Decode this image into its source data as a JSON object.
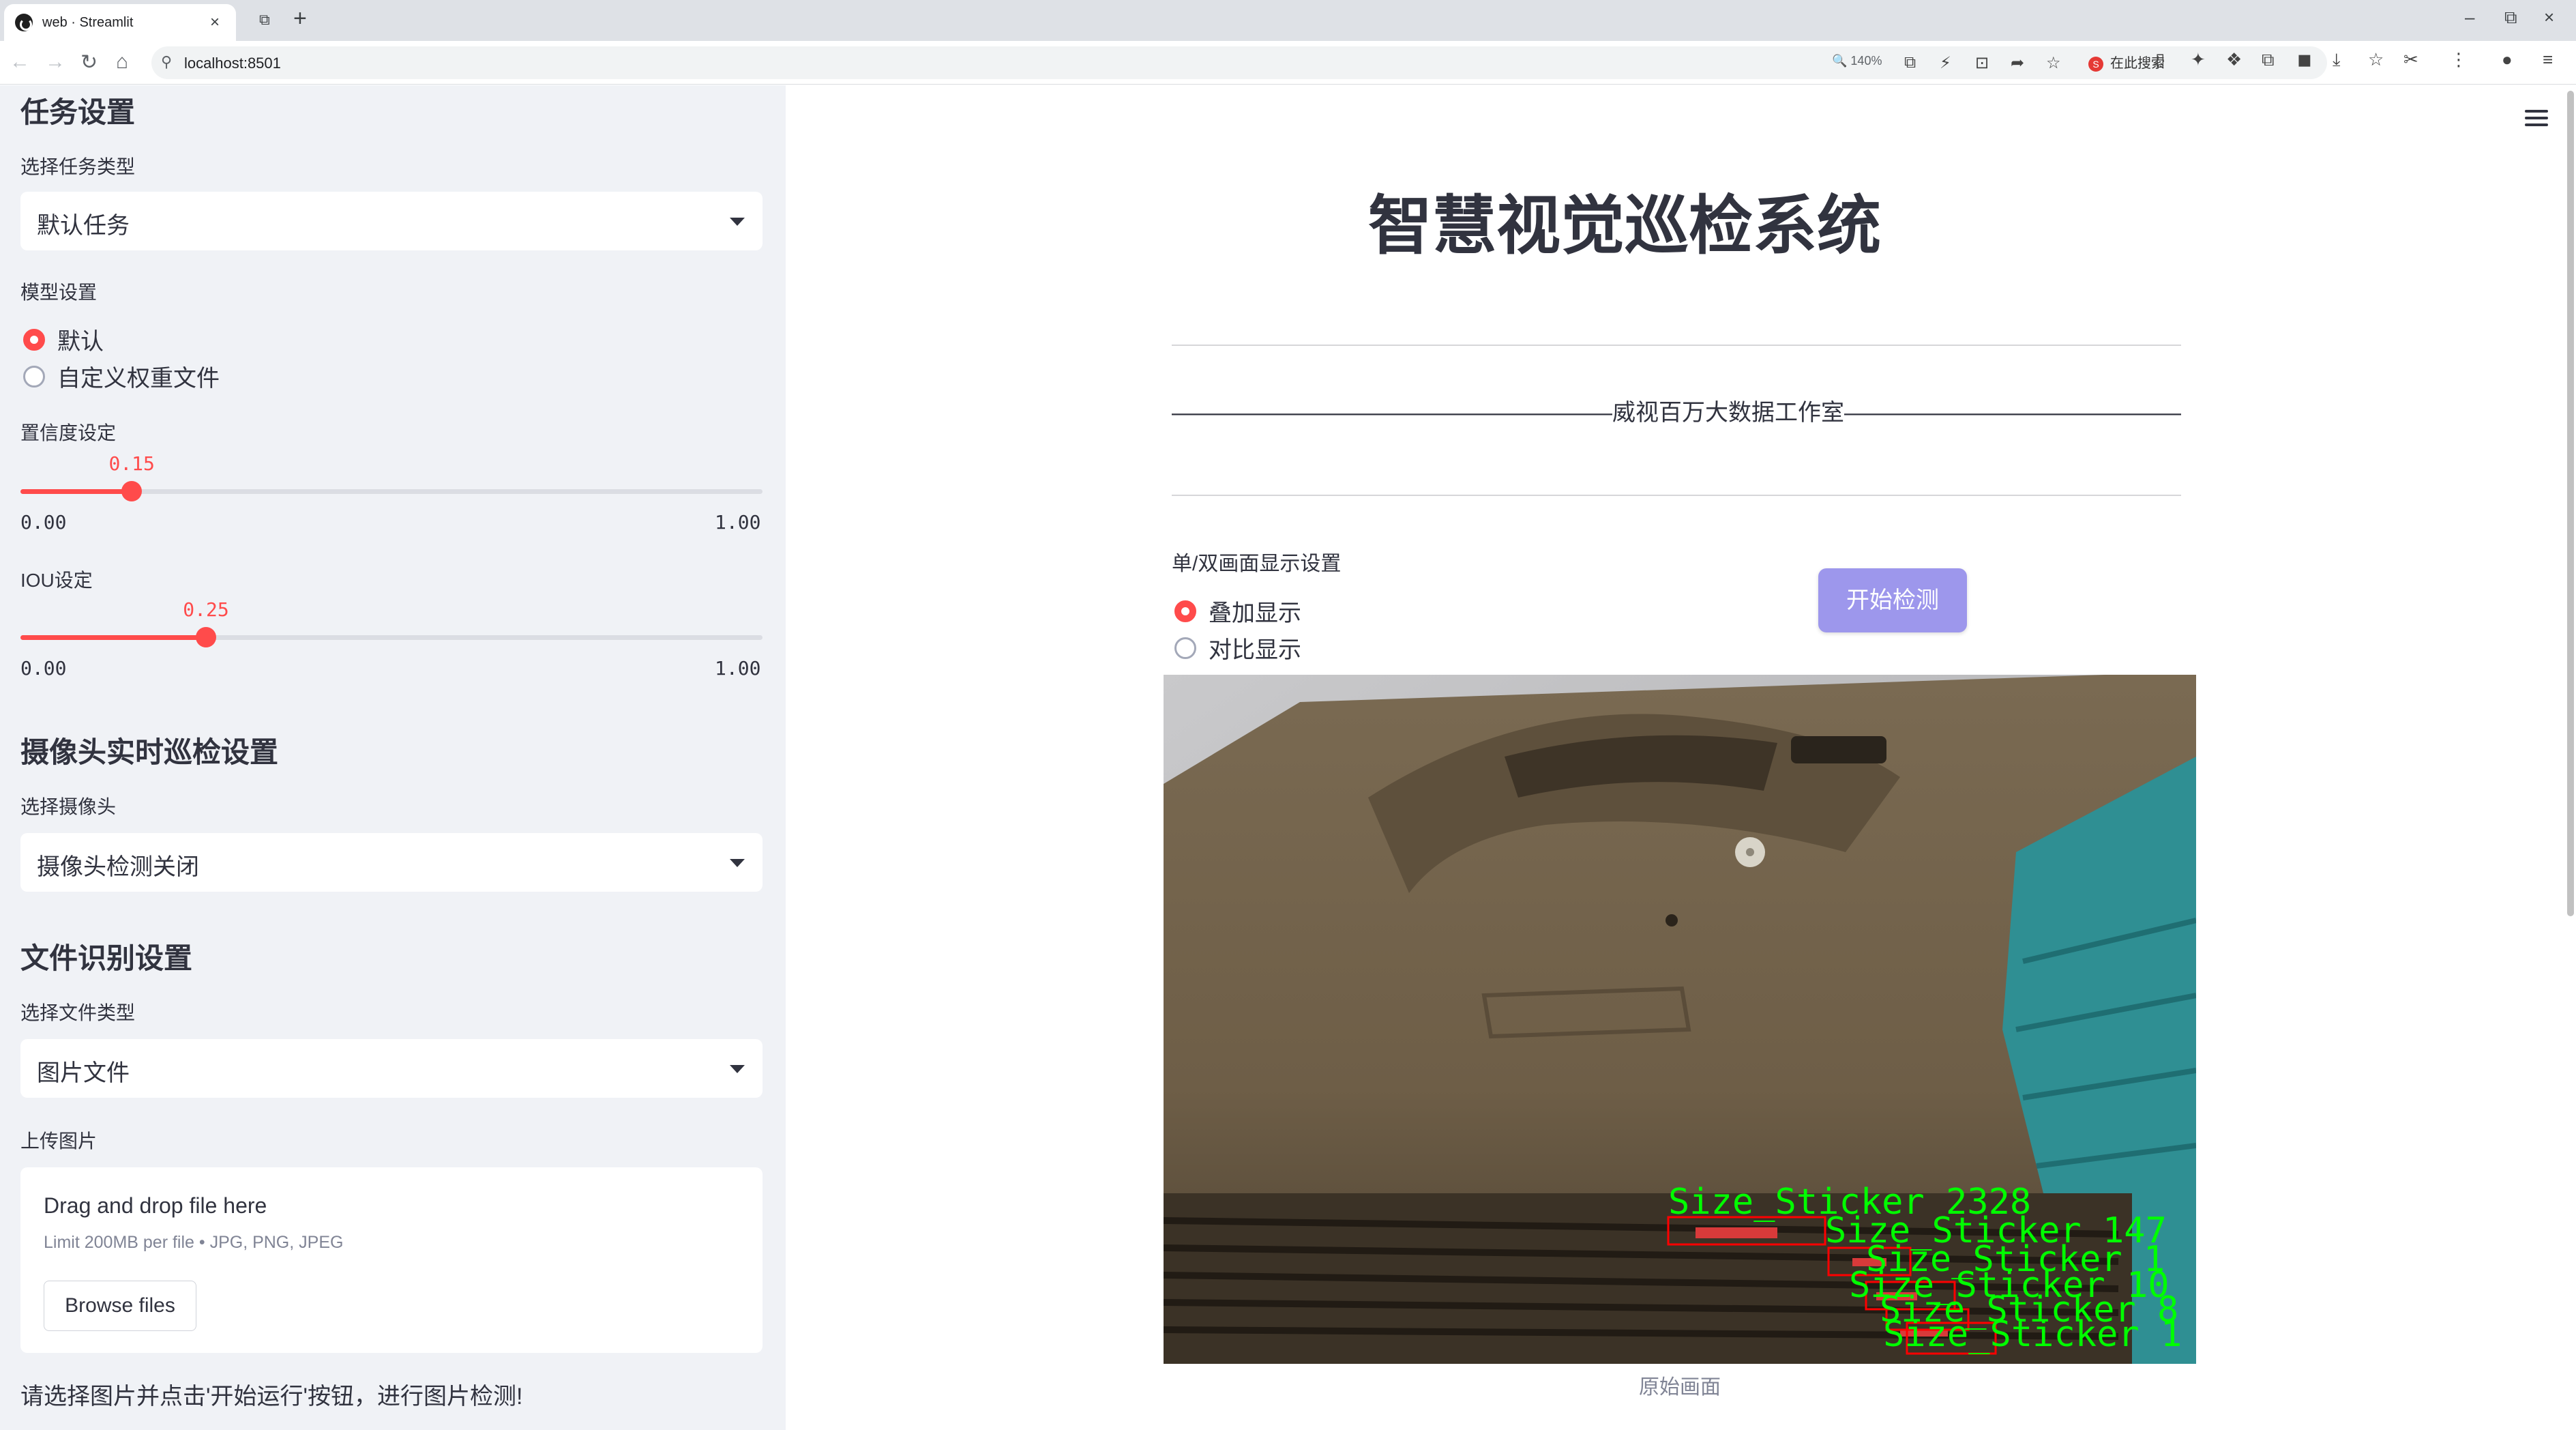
{
  "browser": {
    "tab_title": "web · Streamlit",
    "url": "localhost:8501",
    "zoom": "140%",
    "search_placeholder": "在此搜索"
  },
  "sidebar": {
    "task_section": "任务设置",
    "task_type_label": "选择任务类型",
    "task_type_value": "默认任务",
    "model_label": "模型设置",
    "model_options": [
      "默认",
      "自定义权重文件"
    ],
    "model_selected": "默认",
    "confidence_label": "置信度设定",
    "confidence_value": "0.15",
    "confidence_fraction": 0.15,
    "iou_label": "IOU设定",
    "iou_value": "0.25",
    "iou_fraction": 0.25,
    "slider_min": "0.00",
    "slider_max": "1.00",
    "camera_section": "摄像头实时巡检设置",
    "camera_label": "选择摄像头",
    "camera_value": "摄像头检测关闭",
    "file_section": "文件识别设置",
    "file_type_label": "选择文件类型",
    "file_type_value": "图片文件",
    "upload_label": "上传图片",
    "upload_title": "Drag and drop file here",
    "upload_limit": "Limit 200MB per file • JPG, PNG, JPEG",
    "browse_button": "Browse files",
    "footer_note": "请选择图片并点击'开始运行'按钮，进行图片检测!"
  },
  "main": {
    "title": "智慧视觉巡检系统",
    "studio_line": "———————————————————威视百万大数据工作室————————————————————",
    "display_label": "单/双画面显示设置",
    "display_options": [
      "叠加显示",
      "对比显示"
    ],
    "display_selected": "叠加显示",
    "start_button": "开始检测",
    "image_caption": "原始画面",
    "detections": [
      "Size_Sticker 2328",
      "Size_Sticker 147",
      "Size_Sticker 1",
      "Size_Sticker 10",
      "Size_Sticker 8",
      "Size_Sticker 1"
    ],
    "detection_color": "#00ff00",
    "box_color": "#ff0000"
  },
  "colors": {
    "accent": "#ff4b4b",
    "button": "#9d97ec",
    "sidebar_bg": "#f0f2f6"
  }
}
